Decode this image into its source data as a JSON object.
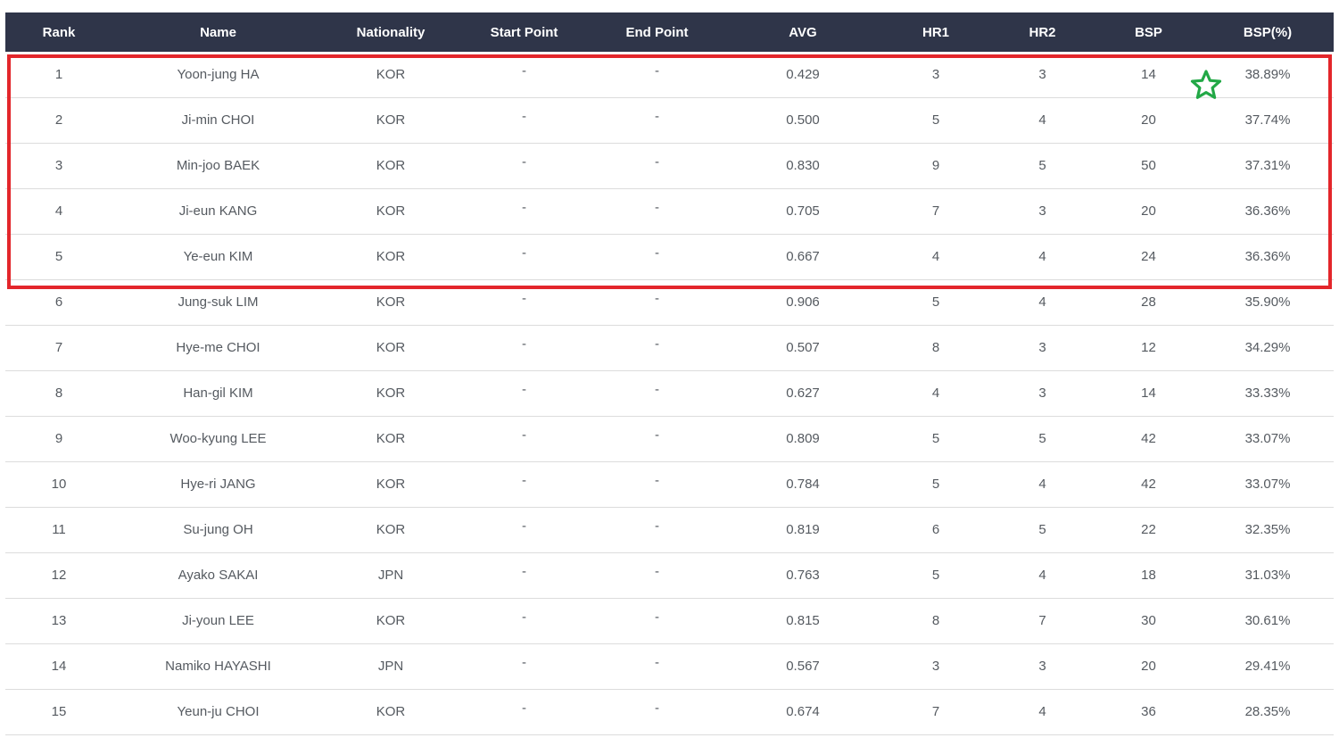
{
  "table": {
    "columns": [
      "Rank",
      "Name",
      "Nationality",
      "Start Point",
      "End Point",
      "AVG",
      "HR1",
      "HR2",
      "BSP",
      "BSP(%)"
    ],
    "rows": [
      {
        "rank": "1",
        "name": "Yoon-jung HA",
        "nationality": "KOR",
        "start": "-",
        "end": "-",
        "avg": "0.429",
        "hr1": "3",
        "hr2": "3",
        "bsp": "14",
        "bsp_pct": "38.89%"
      },
      {
        "rank": "2",
        "name": "Ji-min CHOI",
        "nationality": "KOR",
        "start": "-",
        "end": "-",
        "avg": "0.500",
        "hr1": "5",
        "hr2": "4",
        "bsp": "20",
        "bsp_pct": "37.74%"
      },
      {
        "rank": "3",
        "name": "Min-joo BAEK",
        "nationality": "KOR",
        "start": "-",
        "end": "-",
        "avg": "0.830",
        "hr1": "9",
        "hr2": "5",
        "bsp": "50",
        "bsp_pct": "37.31%"
      },
      {
        "rank": "4",
        "name": "Ji-eun KANG",
        "nationality": "KOR",
        "start": "-",
        "end": "-",
        "avg": "0.705",
        "hr1": "7",
        "hr2": "3",
        "bsp": "20",
        "bsp_pct": "36.36%"
      },
      {
        "rank": "5",
        "name": "Ye-eun KIM",
        "nationality": "KOR",
        "start": "-",
        "end": "-",
        "avg": "0.667",
        "hr1": "4",
        "hr2": "4",
        "bsp": "24",
        "bsp_pct": "36.36%"
      },
      {
        "rank": "6",
        "name": "Jung-suk LIM",
        "nationality": "KOR",
        "start": "-",
        "end": "-",
        "avg": "0.906",
        "hr1": "5",
        "hr2": "4",
        "bsp": "28",
        "bsp_pct": "35.90%"
      },
      {
        "rank": "7",
        "name": "Hye-me CHOI",
        "nationality": "KOR",
        "start": "-",
        "end": "-",
        "avg": "0.507",
        "hr1": "8",
        "hr2": "3",
        "bsp": "12",
        "bsp_pct": "34.29%"
      },
      {
        "rank": "8",
        "name": "Han-gil KIM",
        "nationality": "KOR",
        "start": "-",
        "end": "-",
        "avg": "0.627",
        "hr1": "4",
        "hr2": "3",
        "bsp": "14",
        "bsp_pct": "33.33%"
      },
      {
        "rank": "9",
        "name": "Woo-kyung LEE",
        "nationality": "KOR",
        "start": "-",
        "end": "-",
        "avg": "0.809",
        "hr1": "5",
        "hr2": "5",
        "bsp": "42",
        "bsp_pct": "33.07%"
      },
      {
        "rank": "10",
        "name": "Hye-ri JANG",
        "nationality": "KOR",
        "start": "-",
        "end": "-",
        "avg": "0.784",
        "hr1": "5",
        "hr2": "4",
        "bsp": "42",
        "bsp_pct": "33.07%"
      },
      {
        "rank": "11",
        "name": "Su-jung OH",
        "nationality": "KOR",
        "start": "-",
        "end": "-",
        "avg": "0.819",
        "hr1": "6",
        "hr2": "5",
        "bsp": "22",
        "bsp_pct": "32.35%"
      },
      {
        "rank": "12",
        "name": "Ayako SAKAI",
        "nationality": "JPN",
        "start": "-",
        "end": "-",
        "avg": "0.763",
        "hr1": "5",
        "hr2": "4",
        "bsp": "18",
        "bsp_pct": "31.03%"
      },
      {
        "rank": "13",
        "name": "Ji-youn LEE",
        "nationality": "KOR",
        "start": "-",
        "end": "-",
        "avg": "0.815",
        "hr1": "8",
        "hr2": "7",
        "bsp": "30",
        "bsp_pct": "30.61%"
      },
      {
        "rank": "14",
        "name": "Namiko HAYASHI",
        "nationality": "JPN",
        "start": "-",
        "end": "-",
        "avg": "0.567",
        "hr1": "3",
        "hr2": "3",
        "bsp": "20",
        "bsp_pct": "29.41%"
      },
      {
        "rank": "15",
        "name": "Yeun-ju CHOI",
        "nationality": "KOR",
        "start": "-",
        "end": "-",
        "avg": "0.674",
        "hr1": "7",
        "hr2": "4",
        "bsp": "36",
        "bsp_pct": "28.35%"
      }
    ]
  },
  "annotations": {
    "highlight_color": "#e3262b",
    "star_icon": "star-outline-icon",
    "star_color": "#22a846"
  },
  "colors": {
    "header_bg": "#2f3549",
    "header_text": "#ffffff",
    "cell_text": "#555a60",
    "row_divider": "#dcdcdc"
  }
}
